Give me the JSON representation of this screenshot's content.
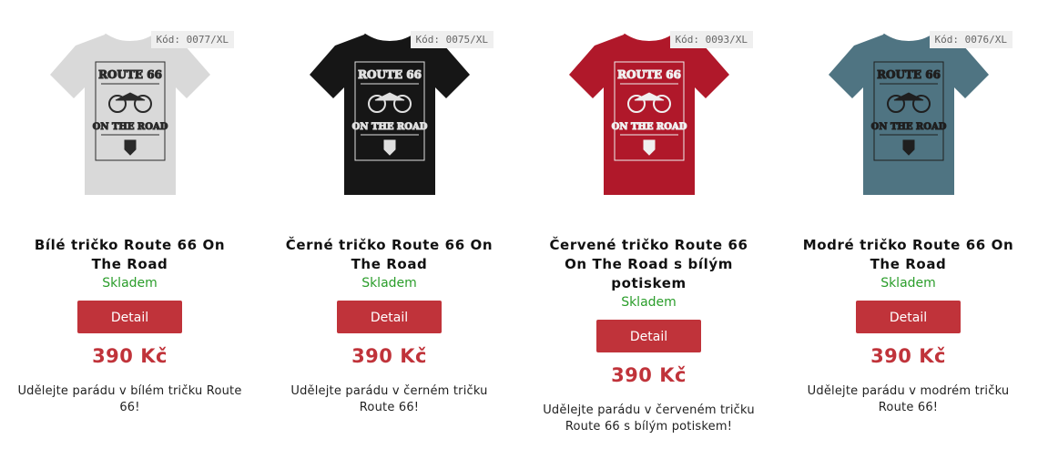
{
  "products": [
    {
      "code": "Kód: 0077/XL",
      "title": "Bílé tričko Route 66 On The Road",
      "stock": "Skladem",
      "button": "Detail",
      "price": "390 Kč",
      "description": "Udělejte parádu v bílém tričku Route 66!",
      "shirt_color": "#d9d9d9",
      "print_color": "#2a2a2a"
    },
    {
      "code": "Kód: 0075/XL",
      "title": "Černé tričko Route 66 On The Road",
      "stock": "Skladem",
      "button": "Detail",
      "price": "390 Kč",
      "description": "Udělejte parádu v černém tričku Route 66!",
      "shirt_color": "#161616",
      "print_color": "#e0e0e0"
    },
    {
      "code": "Kód: 0093/XL",
      "title": "Červené tričko Route 66 On The Road s bílým potiskem",
      "stock": "Skladem",
      "button": "Detail",
      "price": "390 Kč",
      "description": "Udělejte parádu v červeném tričku Route 66 s bílým potiskem!",
      "shirt_color": "#b0182a",
      "print_color": "#f0f0f0"
    },
    {
      "code": "Kód: 0076/XL",
      "title": "Modré tričko Route 66 On The Road",
      "stock": "Skladem",
      "button": "Detail",
      "price": "390 Kč",
      "description": "Udělejte parádu v modrém tričku Route 66!",
      "shirt_color": "#4f7482",
      "print_color": "#1f1f1f"
    }
  ],
  "print": {
    "top": "ROUTE 66",
    "bottom": "ON THE ROAD"
  },
  "colors": {
    "accent": "#c0333a",
    "stock": "#2a9d2a"
  }
}
